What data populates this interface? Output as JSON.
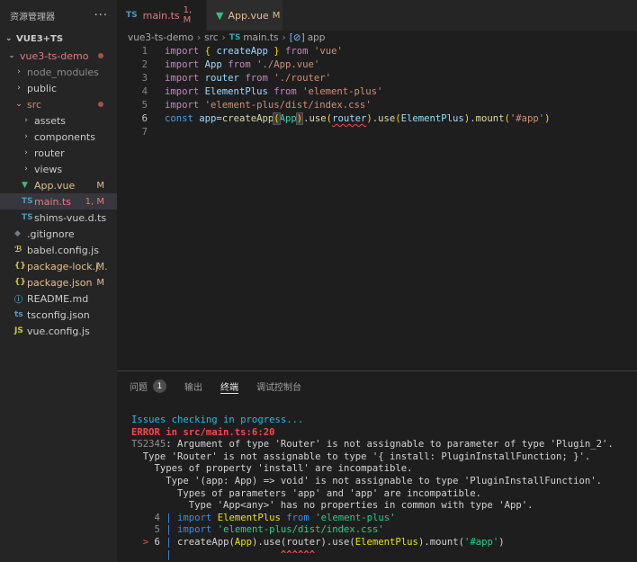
{
  "explorer": {
    "title": "资源管理器",
    "more": "···",
    "root": "VUE3+TS",
    "items": [
      {
        "label": "vue3-ts-demo",
        "indent": 0,
        "chevron": "open",
        "icon": "",
        "status": "",
        "dot": true
      },
      {
        "label": "node_modules",
        "indent": 1,
        "chevron": "closed",
        "icon": "",
        "status": "",
        "muted": true
      },
      {
        "label": "public",
        "indent": 1,
        "chevron": "closed",
        "icon": "",
        "status": ""
      },
      {
        "label": "src",
        "indent": 1,
        "chevron": "open",
        "icon": "",
        "status": "",
        "dot": true
      },
      {
        "label": "assets",
        "indent": 2,
        "chevron": "closed",
        "icon": "",
        "status": ""
      },
      {
        "label": "components",
        "indent": 2,
        "chevron": "closed",
        "icon": "",
        "status": ""
      },
      {
        "label": "router",
        "indent": 2,
        "chevron": "closed",
        "icon": "",
        "status": ""
      },
      {
        "label": "views",
        "indent": 2,
        "chevron": "closed",
        "icon": "",
        "status": ""
      },
      {
        "label": "App.vue",
        "indent": 2,
        "chevron": "none",
        "icon": "vue",
        "status": "M"
      },
      {
        "label": "main.ts",
        "indent": 2,
        "chevron": "none",
        "icon": "ts",
        "status": "1, M",
        "selected": true
      },
      {
        "label": "shims-vue.d.ts",
        "indent": 2,
        "chevron": "none",
        "icon": "ts",
        "status": ""
      },
      {
        "label": ".gitignore",
        "indent": 1,
        "chevron": "none",
        "icon": "git",
        "status": ""
      },
      {
        "label": "babel.config.js",
        "indent": 1,
        "chevron": "none",
        "icon": "babel",
        "status": ""
      },
      {
        "label": "package-lock.j...",
        "indent": 1,
        "chevron": "none",
        "icon": "json",
        "status": "M"
      },
      {
        "label": "package.json",
        "indent": 1,
        "chevron": "none",
        "icon": "json",
        "status": "M"
      },
      {
        "label": "README.md",
        "indent": 1,
        "chevron": "none",
        "icon": "info",
        "status": ""
      },
      {
        "label": "tsconfig.json",
        "indent": 1,
        "chevron": "none",
        "icon": "tsconfig",
        "status": ""
      },
      {
        "label": "vue.config.js",
        "indent": 1,
        "chevron": "none",
        "icon": "js",
        "status": ""
      }
    ]
  },
  "tabs": [
    {
      "label": "main.ts",
      "icon": "TS",
      "badge": "1, M",
      "active": true,
      "dirty": true
    },
    {
      "label": "App.vue",
      "icon": "vue",
      "badge": "M",
      "active": false
    }
  ],
  "breadcrumb": {
    "parts": [
      "vue3-ts-demo",
      "src",
      "main.ts",
      "app"
    ],
    "file_icon": "TS"
  },
  "editor": {
    "line_numbers": [
      "1",
      "2",
      "3",
      "4",
      "5",
      "6",
      "7"
    ],
    "current_line": "6"
  },
  "panel": {
    "tabs": [
      {
        "label": "问题",
        "badge": "1"
      },
      {
        "label": "输出",
        "badge": ""
      },
      {
        "label": "终端",
        "badge": "",
        "active": true
      },
      {
        "label": "调试控制台",
        "badge": ""
      }
    ],
    "terminal_lines": [
      "Issues checking in progress...",
      "ERROR in src/main.ts:6:20",
      "TS2345: Argument of type 'Router' is not assignable to parameter of type 'Plugin_2'.",
      "  Type 'Router' is not assignable to type '{ install: PluginInstallFunction; }'.",
      "    Types of property 'install' are incompatible.",
      "      Type '(app: App) => void' is not assignable to type 'PluginInstallFunction'.",
      "        Types of parameters 'app' and 'app' are incompatible.",
      "          Type 'App<any>' has no properties in common with type 'App'.",
      "4",
      "5",
      "6",
      "^^^^^^"
    ]
  },
  "colors": {
    "accent_modified": "#e2c08d",
    "accent_error": "#e27c7c",
    "vue_green": "#41b883",
    "ts_blue": "#519aba"
  }
}
